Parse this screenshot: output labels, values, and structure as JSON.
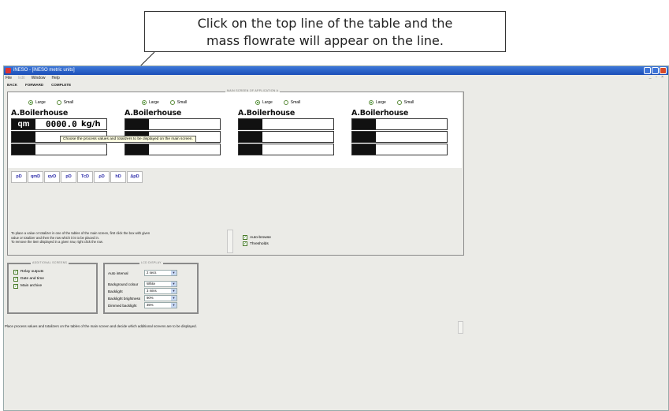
{
  "callout": {
    "line1": "Click on the top line of the table and the",
    "line2": "mass flowrate will appear on the line."
  },
  "window": {
    "title": "iNESO - [iNESO metric units]",
    "menu": [
      "File",
      "Edit",
      "Window",
      "Help"
    ],
    "nav": [
      "BACK",
      "FORWARD",
      "COMPLETE"
    ]
  },
  "main_screen": {
    "group_title": "MAIN SCREEN OF APPLICATION A",
    "panels": [
      {
        "large": "Large",
        "small": "Small",
        "title": "A.Boilerhouse",
        "symbol": "qm",
        "value": "0000.0",
        "unit": "kg/h"
      },
      {
        "large": "Large",
        "small": "Small",
        "title": "A.Boilerhouse"
      },
      {
        "large": "Large",
        "small": "Small",
        "title": "A.Boilerhouse"
      },
      {
        "large": "Large",
        "small": "Small",
        "title": "A.Boilerhouse"
      }
    ],
    "tooltip": "Choose the process values and totalizers to be displayed on the main screen.",
    "param_buttons": [
      "pD",
      "qmD",
      "qvD",
      "pD",
      "TcD",
      "ρD",
      "hD",
      "ΔpD"
    ],
    "hint_lines": [
      "To place a value or totalizer in one of the tables of the main screen, first click the box with given",
      "value or totalizer and then the row which it is to be placed in.",
      "To remove the item displayed in a given row, right click the row."
    ],
    "auto_browse": "Auto-browse",
    "thresholds": "Thresholds"
  },
  "additional_screens": {
    "title": "ADDITIONAL SCREENS",
    "items": [
      "Relay outputs",
      "Date and time",
      "Main archive"
    ]
  },
  "lcd_display": {
    "title": "LCD DISPLAY",
    "rows": [
      {
        "label": "Auto interval",
        "value": "2 secs"
      },
      {
        "label": "Background colour",
        "value": "White"
      },
      {
        "label": "Backlight",
        "value": "3 mins"
      },
      {
        "label": "Backlight brightness",
        "value": "90%"
      },
      {
        "label": "Dimmed backlight",
        "value": "35%"
      }
    ]
  },
  "status_text": "Place process values and totalizers on the tables of the main screen and decide which additional screens are to be displayed."
}
